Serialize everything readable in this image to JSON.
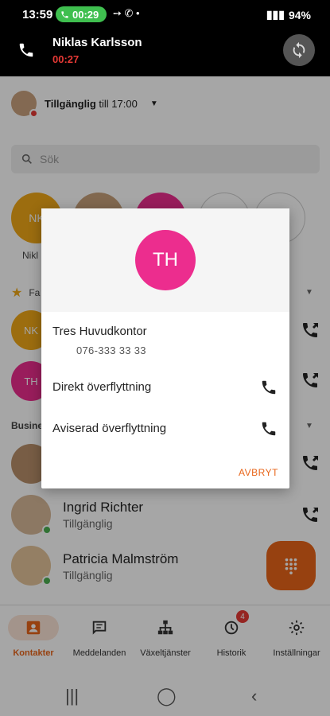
{
  "status_bar": {
    "time": "13:59",
    "call_timer": "00:29",
    "battery": "94%"
  },
  "active_call": {
    "name": "Niklas Karlsson",
    "duration": "00:27"
  },
  "presence": {
    "status_bold": "Tillgänglig",
    "status_rest": "till 17:00"
  },
  "search": {
    "placeholder": "Sök"
  },
  "favorites_row": {
    "first_initials": "NK",
    "first_label": "Nikl"
  },
  "sections": {
    "favorites_partial": "Fa",
    "business_partial": "Busine"
  },
  "contacts": [
    {
      "initials": "NK"
    },
    {
      "initials": "TH"
    },
    {
      "initials": ""
    },
    {
      "name": "Ingrid Richter",
      "status": "Tillgänglig"
    },
    {
      "name": "Patricia Malmström",
      "status": "Tillgänglig"
    }
  ],
  "bottom_nav": {
    "items": [
      {
        "label": "Kontakter"
      },
      {
        "label": "Meddelanden"
      },
      {
        "label": "Växeltjänster"
      },
      {
        "label": "Historik",
        "badge": "4"
      },
      {
        "label": "Inställningar"
      }
    ]
  },
  "dialog": {
    "initials": "TH",
    "contact_name": "Tres Huvudkontor",
    "number": "076-333 33 33",
    "option_direct": "Direkt överflyttning",
    "option_announced": "Aviserad överflyttning",
    "cancel": "AVBRYT"
  },
  "colors": {
    "accent": "#e8651a",
    "avatar_pink": "#ec2d8e",
    "avatar_yellow": "#f0a818",
    "online": "#4caf50",
    "call_green": "#3fbf4f"
  }
}
